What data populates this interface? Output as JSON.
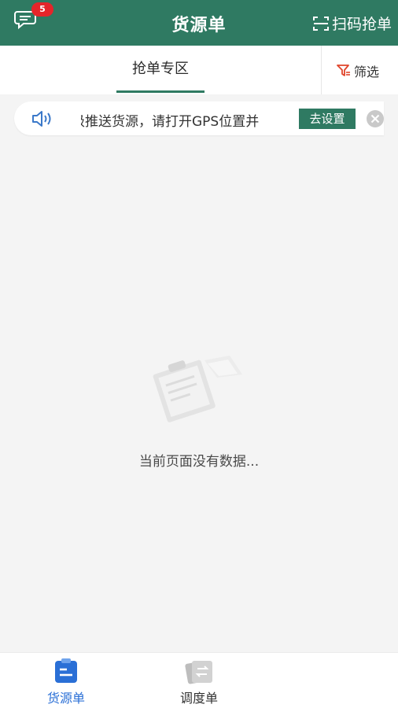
{
  "header": {
    "title": "货源单",
    "message_badge": "5",
    "scan_label": "扫码抢单"
  },
  "tabs": {
    "grab_zone": "抢单专区",
    "filter_label": "筛选"
  },
  "notice": {
    "text": "级推送货源，请打开GPS位置并",
    "action_label": "去设置"
  },
  "empty": {
    "message": "当前页面没有数据..."
  },
  "bottom_nav": {
    "items": [
      {
        "label": "货源单",
        "active": true
      },
      {
        "label": "调度单",
        "active": false
      }
    ]
  },
  "colors": {
    "primary": "#2f7a62",
    "badge": "#e5252a",
    "nav_active": "#2a6fd6"
  }
}
